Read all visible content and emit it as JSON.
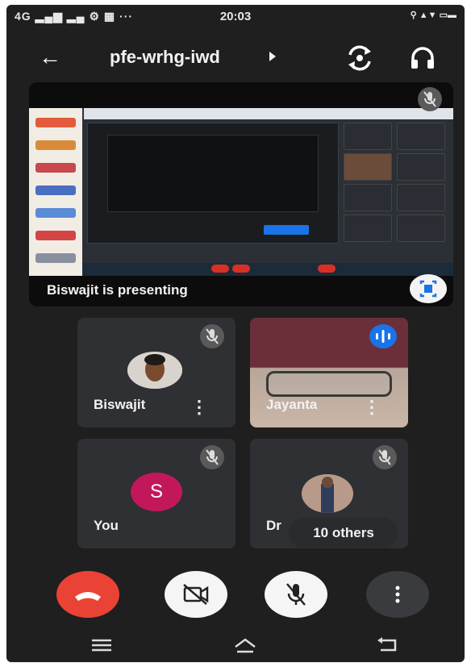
{
  "status_bar": {
    "network": "4G",
    "time": "20:03"
  },
  "header": {
    "meeting_code": "pfe-wrhg-iwd"
  },
  "presentation": {
    "label": "Biswajit is presenting"
  },
  "participants": [
    {
      "name": "Biswajit"
    },
    {
      "name": "Jayanta"
    },
    {
      "name": "You",
      "initial": "S"
    },
    {
      "name": "Dr"
    }
  ],
  "others_pill": "10 others",
  "icons": {
    "back": "back-arrow-icon",
    "caret": "caret-right-icon",
    "switch_camera": "switch-camera-icon",
    "audio": "headphones-icon",
    "mic_off": "mic-off-icon",
    "fullscreen": "fullscreen-icon",
    "speaking": "speaking-icon",
    "more": "more-vert-icon",
    "hangup": "call-end-icon",
    "camera_off": "videocam-off-icon",
    "home": "home-icon",
    "menu": "menu-icon",
    "back_nav": "return-icon"
  },
  "colors": {
    "background": "#1f1f1f",
    "tile": "#2f3033",
    "hangup": "#ea4335",
    "avatar_s": "#c2185b",
    "speaking": "#1a73e8"
  }
}
